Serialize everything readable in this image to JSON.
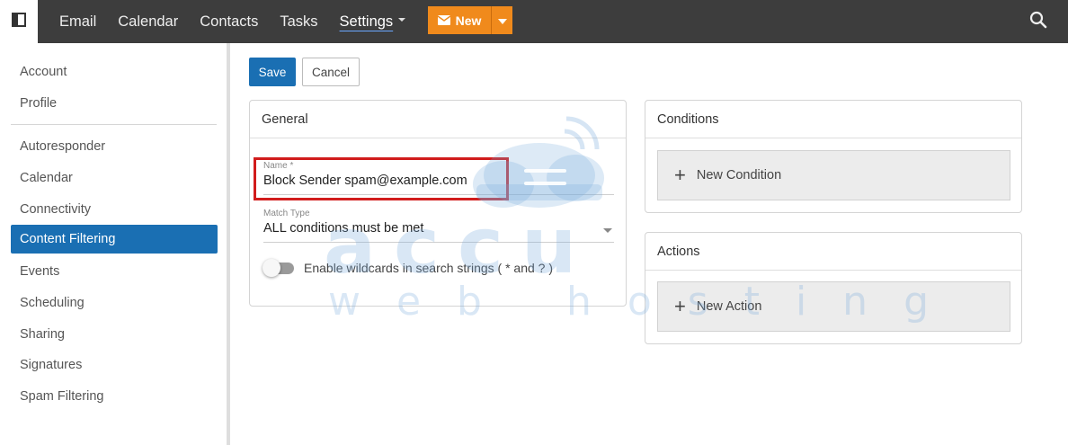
{
  "topbar": {
    "nav": [
      "Email",
      "Calendar",
      "Contacts",
      "Tasks"
    ],
    "settings_label": "Settings",
    "new_label": "New"
  },
  "sidebar": {
    "items": [
      "Account",
      "Profile",
      "Autoresponder",
      "Calendar",
      "Connectivity",
      "Content Filtering",
      "Events",
      "Scheduling",
      "Sharing",
      "Signatures",
      "Spam Filtering"
    ],
    "active": "Content Filtering"
  },
  "toolbar": {
    "save_label": "Save",
    "cancel_label": "Cancel"
  },
  "general": {
    "title": "General",
    "name_label": "Name *",
    "name_value": "Block Sender spam@example.com",
    "match_label": "Match Type",
    "match_value": "ALL conditions must be met",
    "wildcard_label": "Enable wildcards in search strings ( * and ? )",
    "wildcard_enabled": false
  },
  "conditions": {
    "title": "Conditions",
    "add_label": "New Condition"
  },
  "actions": {
    "title": "Actions",
    "add_label": "New Action"
  },
  "watermark": {
    "line1": "accu",
    "line2": "web hosting"
  },
  "colors": {
    "accent": "#1a6fb3",
    "new_button": "#f08a1c",
    "topbar": "#3d3d3d",
    "highlight": "#d11c1c"
  }
}
